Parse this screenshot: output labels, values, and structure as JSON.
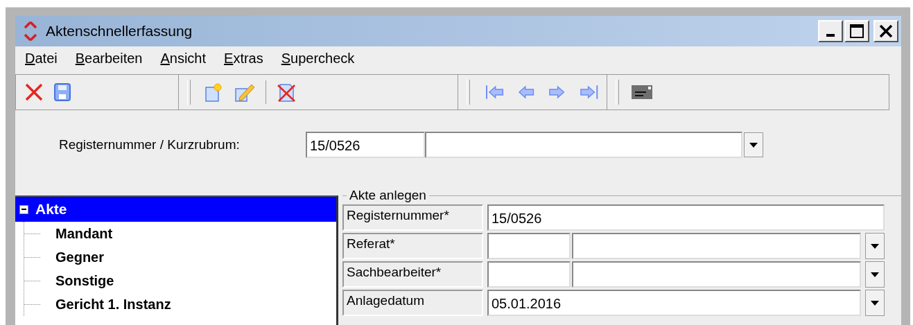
{
  "window": {
    "title": "Aktenschnellerfassung"
  },
  "menu": [
    {
      "accel": "D",
      "rest": "atei"
    },
    {
      "accel": "B",
      "rest": "earbeiten"
    },
    {
      "accel": "A",
      "rest": "nsicht"
    },
    {
      "accel": "E",
      "rest": "xtras"
    },
    {
      "accel": "S",
      "rest": "upercheck"
    }
  ],
  "lookup": {
    "label": "Registernummer / Kurzrubrum:",
    "value": "15/0526"
  },
  "tree": [
    {
      "label": "Akte",
      "expanded": true,
      "selected": true,
      "children": [
        {
          "label": "Mandant",
          "selected": false
        },
        {
          "label": "Gegner",
          "selected": false
        },
        {
          "label": "Sonstige",
          "selected": false
        },
        {
          "label": "Gericht 1. Instanz",
          "selected": false
        }
      ]
    }
  ],
  "form": {
    "legend": "Akte anlegen",
    "rows": [
      {
        "kind": "text",
        "label": "Registernummer*",
        "value": "15/0526"
      },
      {
        "kind": "lookup",
        "label": "Referat*"
      },
      {
        "kind": "lookup",
        "label": "Sachbearbeiter*"
      },
      {
        "kind": "date",
        "label": "Anlagedatum",
        "value": "05.01.2016"
      }
    ]
  }
}
